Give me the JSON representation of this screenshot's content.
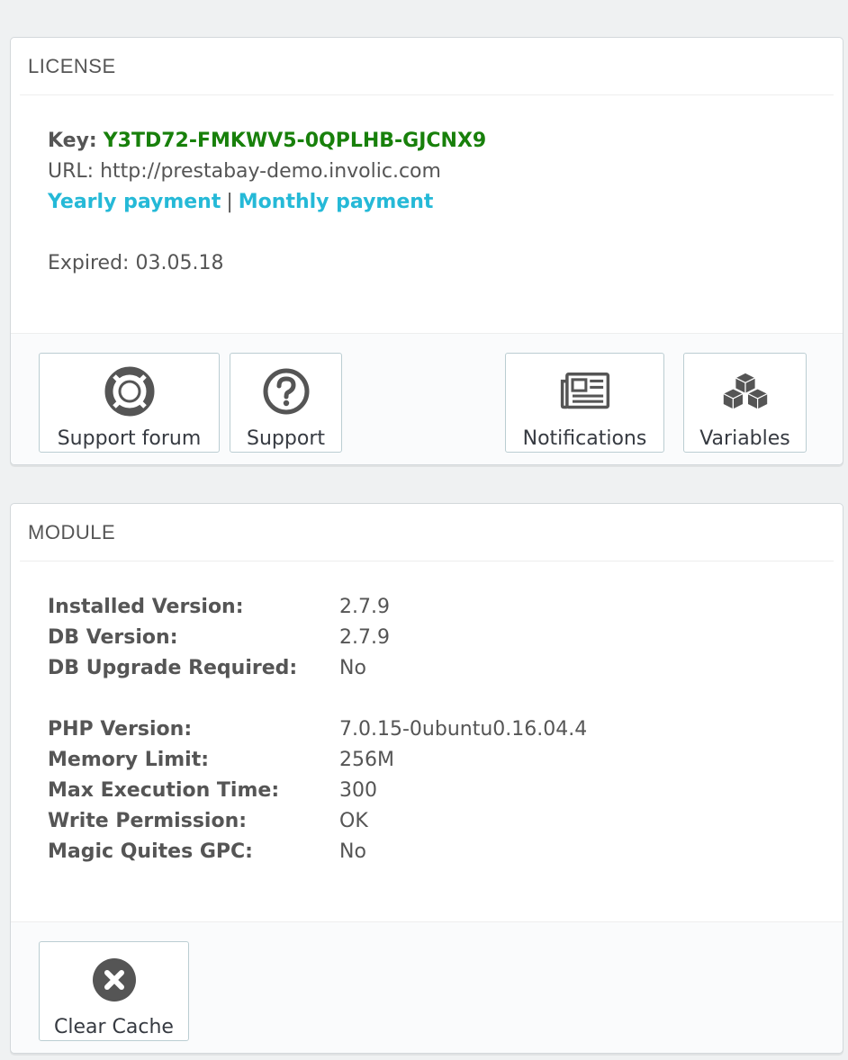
{
  "license": {
    "title": "LICENSE",
    "key_label": "Key:",
    "key_value": "Y3TD72-FMKWV5-0QPLHB-GJCNX9",
    "url_label": "URL:",
    "url_value": "http://prestabay-demo.involic.com",
    "yearly_link": "Yearly payment",
    "separator": "|",
    "monthly_link": "Monthly payment",
    "expired_label": "Expired:",
    "expired_value": "03.05.18",
    "buttons": {
      "support_forum": "Support forum",
      "support": "Support",
      "notifications": "Notifications",
      "variables": "Variables"
    }
  },
  "module": {
    "title": "MODULE",
    "group1": [
      {
        "label": "Installed Version:",
        "value": "2.7.9"
      },
      {
        "label": "DB Version:",
        "value": "2.7.9"
      },
      {
        "label": "DB Upgrade Required:",
        "value": "No"
      }
    ],
    "group2": [
      {
        "label": "PHP Version:",
        "value": "7.0.15-0ubuntu0.16.04.4"
      },
      {
        "label": "Memory Limit:",
        "value": "256M"
      },
      {
        "label": "Max Execution Time:",
        "value": "300"
      },
      {
        "label": "Write Permission:",
        "value": "OK"
      },
      {
        "label": "Magic Quites GPC:",
        "value": "No"
      }
    ],
    "buttons": {
      "clear_cache": "Clear Cache"
    }
  },
  "icons": {
    "support_forum": "lifebuoy-icon",
    "support": "question-circle-icon",
    "notifications": "newspaper-icon",
    "variables": "cubes-icon",
    "clear_cache": "close-circle-icon"
  },
  "colors": {
    "key": "#18800b",
    "link": "#25b9d7",
    "icon": "#555555",
    "background": "#eff1f2"
  }
}
